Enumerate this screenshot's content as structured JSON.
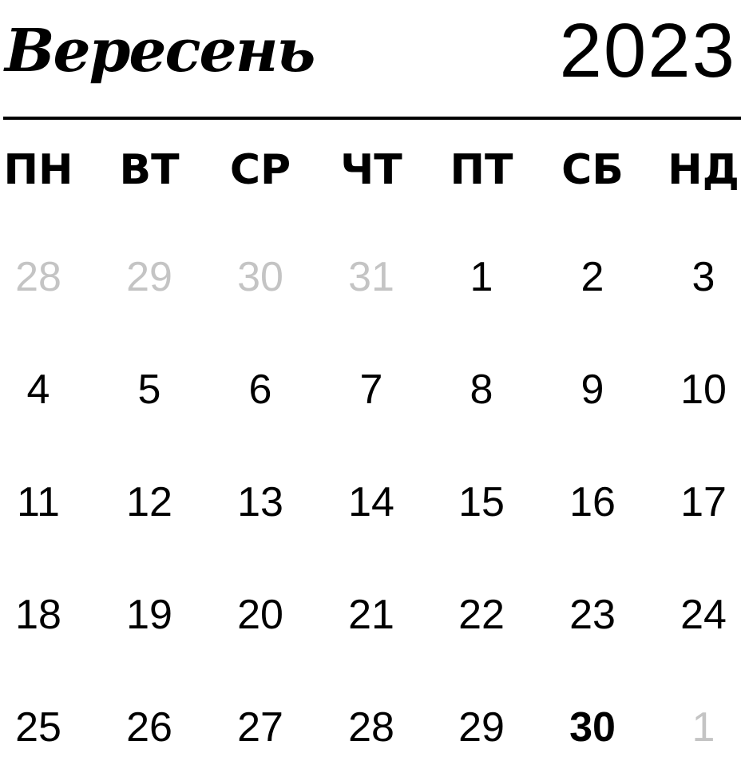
{
  "header": {
    "month": "Вересень",
    "year": "2023"
  },
  "weekdays": [
    "ПН",
    "ВТ",
    "СР",
    "ЧТ",
    "ПТ",
    "СБ",
    "НД"
  ],
  "weeks": [
    [
      {
        "day": "28",
        "muted": true
      },
      {
        "day": "29",
        "muted": true
      },
      {
        "day": "30",
        "muted": true
      },
      {
        "day": "31",
        "muted": true
      },
      {
        "day": "1"
      },
      {
        "day": "2"
      },
      {
        "day": "3"
      }
    ],
    [
      {
        "day": "4"
      },
      {
        "day": "5"
      },
      {
        "day": "6"
      },
      {
        "day": "7"
      },
      {
        "day": "8"
      },
      {
        "day": "9"
      },
      {
        "day": "10"
      }
    ],
    [
      {
        "day": "11"
      },
      {
        "day": "12"
      },
      {
        "day": "13"
      },
      {
        "day": "14"
      },
      {
        "day": "15"
      },
      {
        "day": "16"
      },
      {
        "day": "17"
      }
    ],
    [
      {
        "day": "18"
      },
      {
        "day": "19"
      },
      {
        "day": "20"
      },
      {
        "day": "21"
      },
      {
        "day": "22"
      },
      {
        "day": "23"
      },
      {
        "day": "24"
      }
    ],
    [
      {
        "day": "25"
      },
      {
        "day": "26"
      },
      {
        "day": "27"
      },
      {
        "day": "28"
      },
      {
        "day": "29"
      },
      {
        "day": "30",
        "bold": true
      },
      {
        "day": "1",
        "muted": true
      }
    ]
  ],
  "colors": {
    "text": "#000000",
    "muted": "#c4c4c4",
    "background": "#ffffff"
  }
}
